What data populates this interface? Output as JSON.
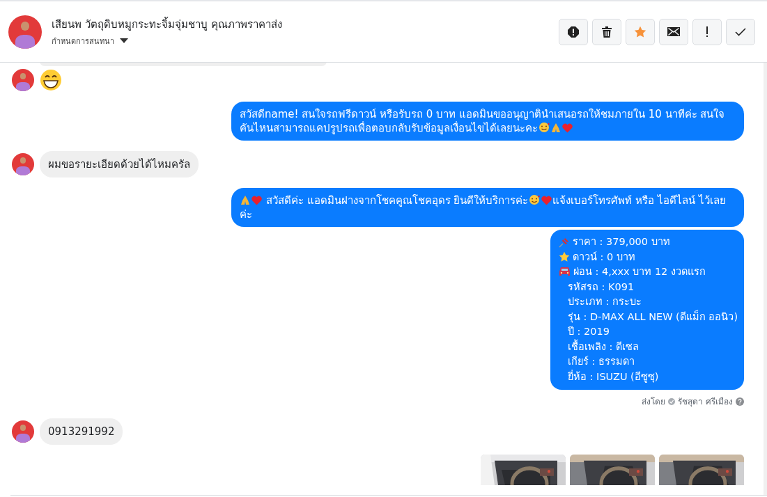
{
  "header": {
    "title": "เสียนพ วัตถุดิบหมูกระทะจิ้มจุ่มชาบู คุณภาพราคาส่ง",
    "subtitle": "กำหนดการสนทนา",
    "actions": [
      {
        "kind": "alert",
        "active": false
      },
      {
        "kind": "trash",
        "active": false
      },
      {
        "kind": "star",
        "active": true
      },
      {
        "kind": "mail",
        "active": false
      },
      {
        "kind": "bang",
        "active": false
      },
      {
        "kind": "check",
        "active": false
      }
    ]
  },
  "messages": [
    {
      "outgoing": false,
      "kind": "clipped"
    },
    {
      "kind": "emoji",
      "parts": [
        {
          "kind": "grin"
        }
      ]
    },
    {
      "outgoing": true,
      "kind": "bubble",
      "parts": [
        {
          "kind": "text",
          "text": "สวัสดีname! สนใจรถฟรีดาวน์ หรือรับรถ 0 บาท แอดมินขออนุญาตินำเสนอรถให้ชมภายใน 10 นาทีค่ะ สนใจคันไหนสามารถแคปรูปรถเพื่อตอบกลับรับข้อมูลเงื่อนไขได้เลยนะคะ"
        },
        {
          "kind": "smile-hearts"
        },
        {
          "kind": "pray"
        },
        {
          "kind": "heart"
        }
      ]
    },
    {
      "outgoing": false,
      "kind": "bubble",
      "parts": [
        {
          "kind": "text",
          "text": "ผมขอรายะเอียดด้วยได้ไหมครัล"
        }
      ]
    },
    {
      "outgoing": true,
      "kind": "bubble",
      "parts": [
        {
          "kind": "pray"
        },
        {
          "kind": "heart"
        },
        {
          "kind": "text",
          "text": " สวัสดีค่ะ แอดมินฝางจากโชคคูณโชคอุดร ยินดีให้บริการค่ะ"
        },
        {
          "kind": "smile-hearts"
        },
        {
          "kind": "heart"
        },
        {
          "kind": "text",
          "text": "แจ้งเบอร์โทรศัพท์ หรือ ไอดีไลน์  ไว้เลยค่ะ"
        }
      ]
    },
    {
      "outgoing": true,
      "kind": "card",
      "lines": [
        {
          "kind": "pin",
          "text": "ราคา : 379,000 บาท"
        },
        {
          "kind": "star",
          "text": "ดาวน์ : 0 บาท"
        },
        {
          "kind": "car",
          "text": "ผ่อน : 4,xxx บาท 12 งวดแรก"
        },
        {
          "kind": "plain",
          "text": "รหัสรถ : K091"
        },
        {
          "kind": "plain",
          "text": "ประเภท : กระบะ"
        },
        {
          "kind": "plain",
          "text": "รุ่น : D-MAX ALL NEW (ดีแม็ก ออนิว)"
        },
        {
          "kind": "plain",
          "text": "ปี : 2019"
        },
        {
          "kind": "plain",
          "text": "เชื้อเพลิง : ดีเซล"
        },
        {
          "kind": "plain",
          "text": "เกียร์ : ธรรมดา"
        },
        {
          "kind": "plain",
          "text": "ยี่ห้อ : ISUZU (อีซูซุ)"
        }
      ],
      "sent_by": {
        "prefix": "ส่งโดย",
        "name": "รัชสุดา ศรีเมือง"
      }
    },
    {
      "outgoing": false,
      "kind": "bubble",
      "parts": [
        {
          "kind": "text",
          "text": "0913291992"
        }
      ]
    },
    {
      "kind": "photos"
    }
  ]
}
